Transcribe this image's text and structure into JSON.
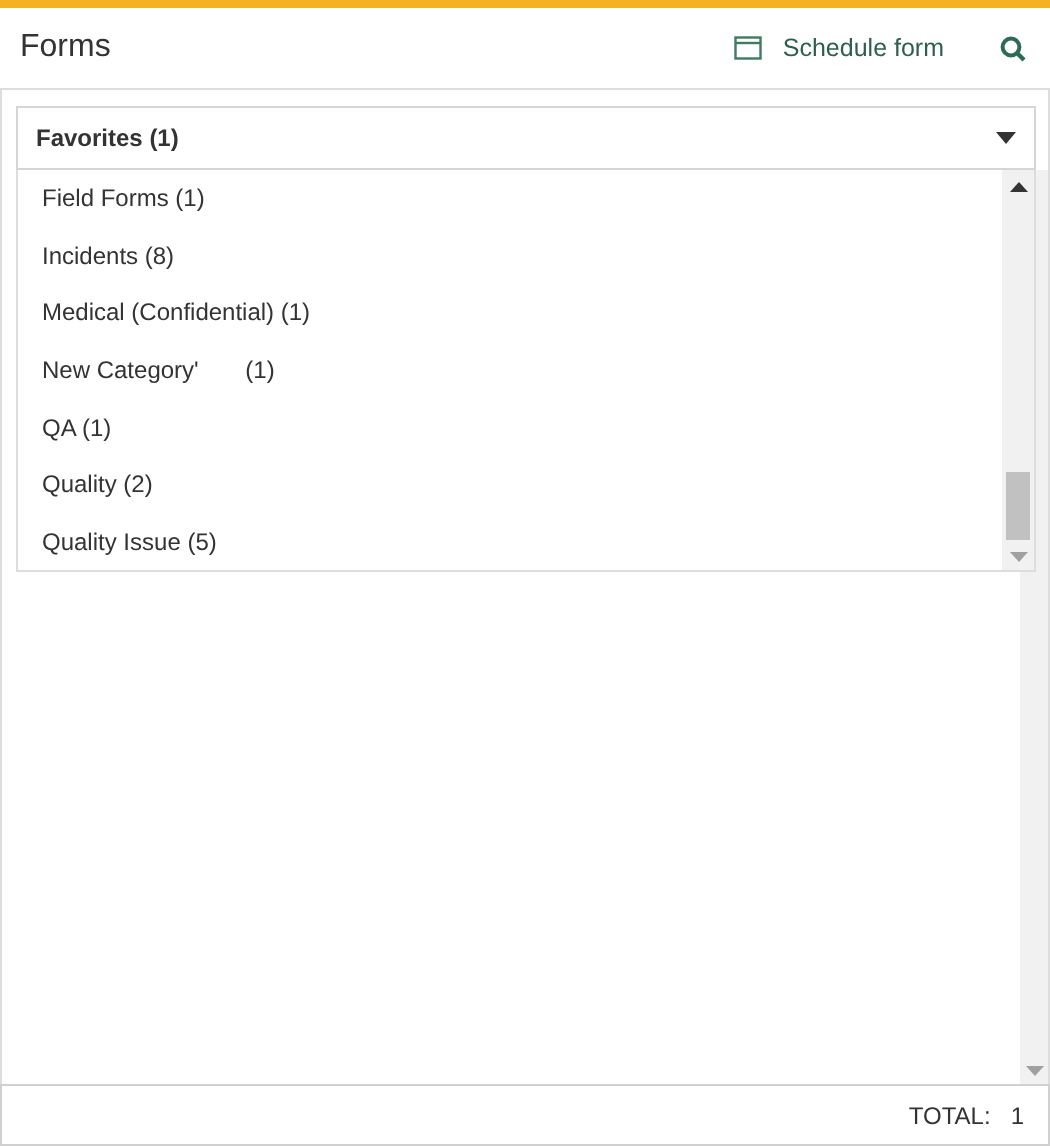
{
  "header": {
    "title": "Forms",
    "schedule_button": "Schedule form"
  },
  "dropdown": {
    "value": "Favorites (1)",
    "expanded": true,
    "options": [
      {
        "label": "Field Forms (1)"
      },
      {
        "label": "Incidents (8)"
      },
      {
        "label": "Medical (Confidential) (1)"
      },
      {
        "label": "New Category'       (1)"
      },
      {
        "label": "QA (1)"
      },
      {
        "label": "Quality (2)"
      },
      {
        "label": "Quality Issue (5)"
      }
    ]
  },
  "footer": {
    "total_label": "TOTAL:",
    "total_value": "1"
  }
}
